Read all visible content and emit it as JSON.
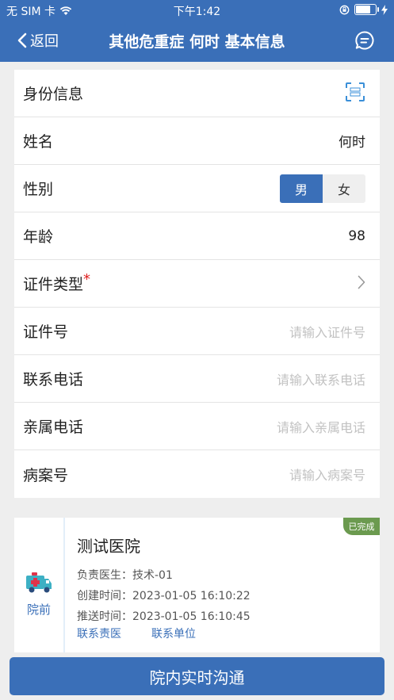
{
  "status_bar": {
    "carrier": "无 SIM 卡",
    "time": "下午1:42"
  },
  "nav": {
    "back_label": "返回",
    "title": "其他危重症 何时 基本信息"
  },
  "form": {
    "section_title": "身份信息",
    "name_label": "姓名",
    "name_value": "何时",
    "gender_label": "性别",
    "gender_options": [
      "男",
      "女"
    ],
    "gender_selected": "男",
    "age_label": "年龄",
    "age_value": "98",
    "id_type_label": "证件类型",
    "id_type_required_mark": "*",
    "id_number_label": "证件号",
    "id_number_placeholder": "请输入证件号",
    "phone_label": "联系电话",
    "phone_placeholder": "请输入联系电话",
    "family_phone_label": "亲属电话",
    "family_phone_placeholder": "请输入亲属电话",
    "record_label": "病案号",
    "record_placeholder": "请输入病案号"
  },
  "hospital": {
    "stage_label": "院前",
    "name": "测试医院",
    "doctor_line": "负责医生：技术-01",
    "created_line": "创建时间：2023-01-05 16:10:22",
    "pushed_line": "推送时间：2023-01-05 16:10:45",
    "contact_doctor": "联系责医",
    "contact_unit": "联系单位",
    "status_badge": "已完成"
  },
  "bottom_button": "院内实时沟通",
  "colors": {
    "primary": "#3a6fb8",
    "badge_green": "#6b9a4f",
    "required_red": "#e02020"
  }
}
